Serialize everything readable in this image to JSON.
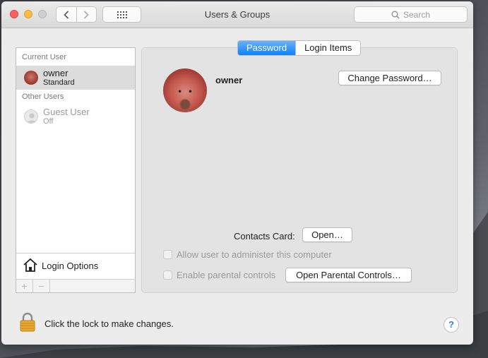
{
  "window": {
    "title": "Users & Groups",
    "search_placeholder": "Search"
  },
  "sidebar": {
    "current_user_label": "Current User",
    "other_users_label": "Other Users",
    "users": [
      {
        "name": "owner",
        "role": "Standard"
      },
      {
        "name": "Guest User",
        "role": "Off"
      }
    ],
    "login_options_label": "Login Options",
    "add_symbol": "+",
    "remove_symbol": "−"
  },
  "tabs": [
    {
      "label": "Password",
      "active": true
    },
    {
      "label": "Login Items",
      "active": false
    }
  ],
  "panel": {
    "user_name": "owner",
    "change_password_label": "Change Password…",
    "contacts_card_label": "Contacts Card:",
    "open_label": "Open…",
    "allow_admin_label": "Allow user to administer this computer",
    "parental_controls_label": "Enable parental controls",
    "open_parental_label": "Open Parental Controls…"
  },
  "footer": {
    "lock_text": "Click the lock to make changes.",
    "help_symbol": "?"
  },
  "colors": {
    "accent": "#0d81ff",
    "close": "#fc605c",
    "minimize": "#fdbc40",
    "lock": "#e8a836"
  },
  "icons": [
    "chevron-left-icon",
    "chevron-right-icon",
    "grid-icon",
    "search-icon",
    "house-icon",
    "lock-icon"
  ]
}
